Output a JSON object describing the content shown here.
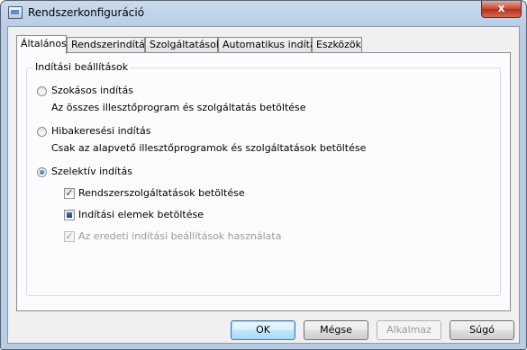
{
  "window": {
    "title": "Rendszerkonfiguráció",
    "close_glyph": "x"
  },
  "tabs": [
    {
      "label": "Általános",
      "active": true
    },
    {
      "label": "Rendszerindítás",
      "active": false
    },
    {
      "label": "Szolgáltatások",
      "active": false
    },
    {
      "label": "Automatikus indítás",
      "active": false
    },
    {
      "label": "Eszközök",
      "active": false
    }
  ],
  "startup_group": {
    "legend": "Indítási beállítások",
    "normal": {
      "label": "Szokásos indítás",
      "description": "Az összes illesztőprogram és szolgáltatás betöltése",
      "selected": false
    },
    "diagnostic": {
      "label": "Hibakeresési indítás",
      "description": "Csak az alapvető illesztőprogramok és szolgáltatások betöltése",
      "selected": false
    },
    "selective": {
      "label": "Szelektív indítás",
      "selected": true
    },
    "options": {
      "load_services": {
        "label": "Rendszerszolgáltatások betöltése",
        "state": "checked"
      },
      "load_startup": {
        "label": "Indítási elemek betöltése",
        "state": "indeterminate"
      },
      "use_original": {
        "label": "Az eredeti indítási beállítások használata",
        "state": "checked-disabled"
      }
    }
  },
  "buttons": {
    "ok": "OK",
    "cancel": "Mégse",
    "apply": "Alkalmaz",
    "help": "Súgó"
  }
}
